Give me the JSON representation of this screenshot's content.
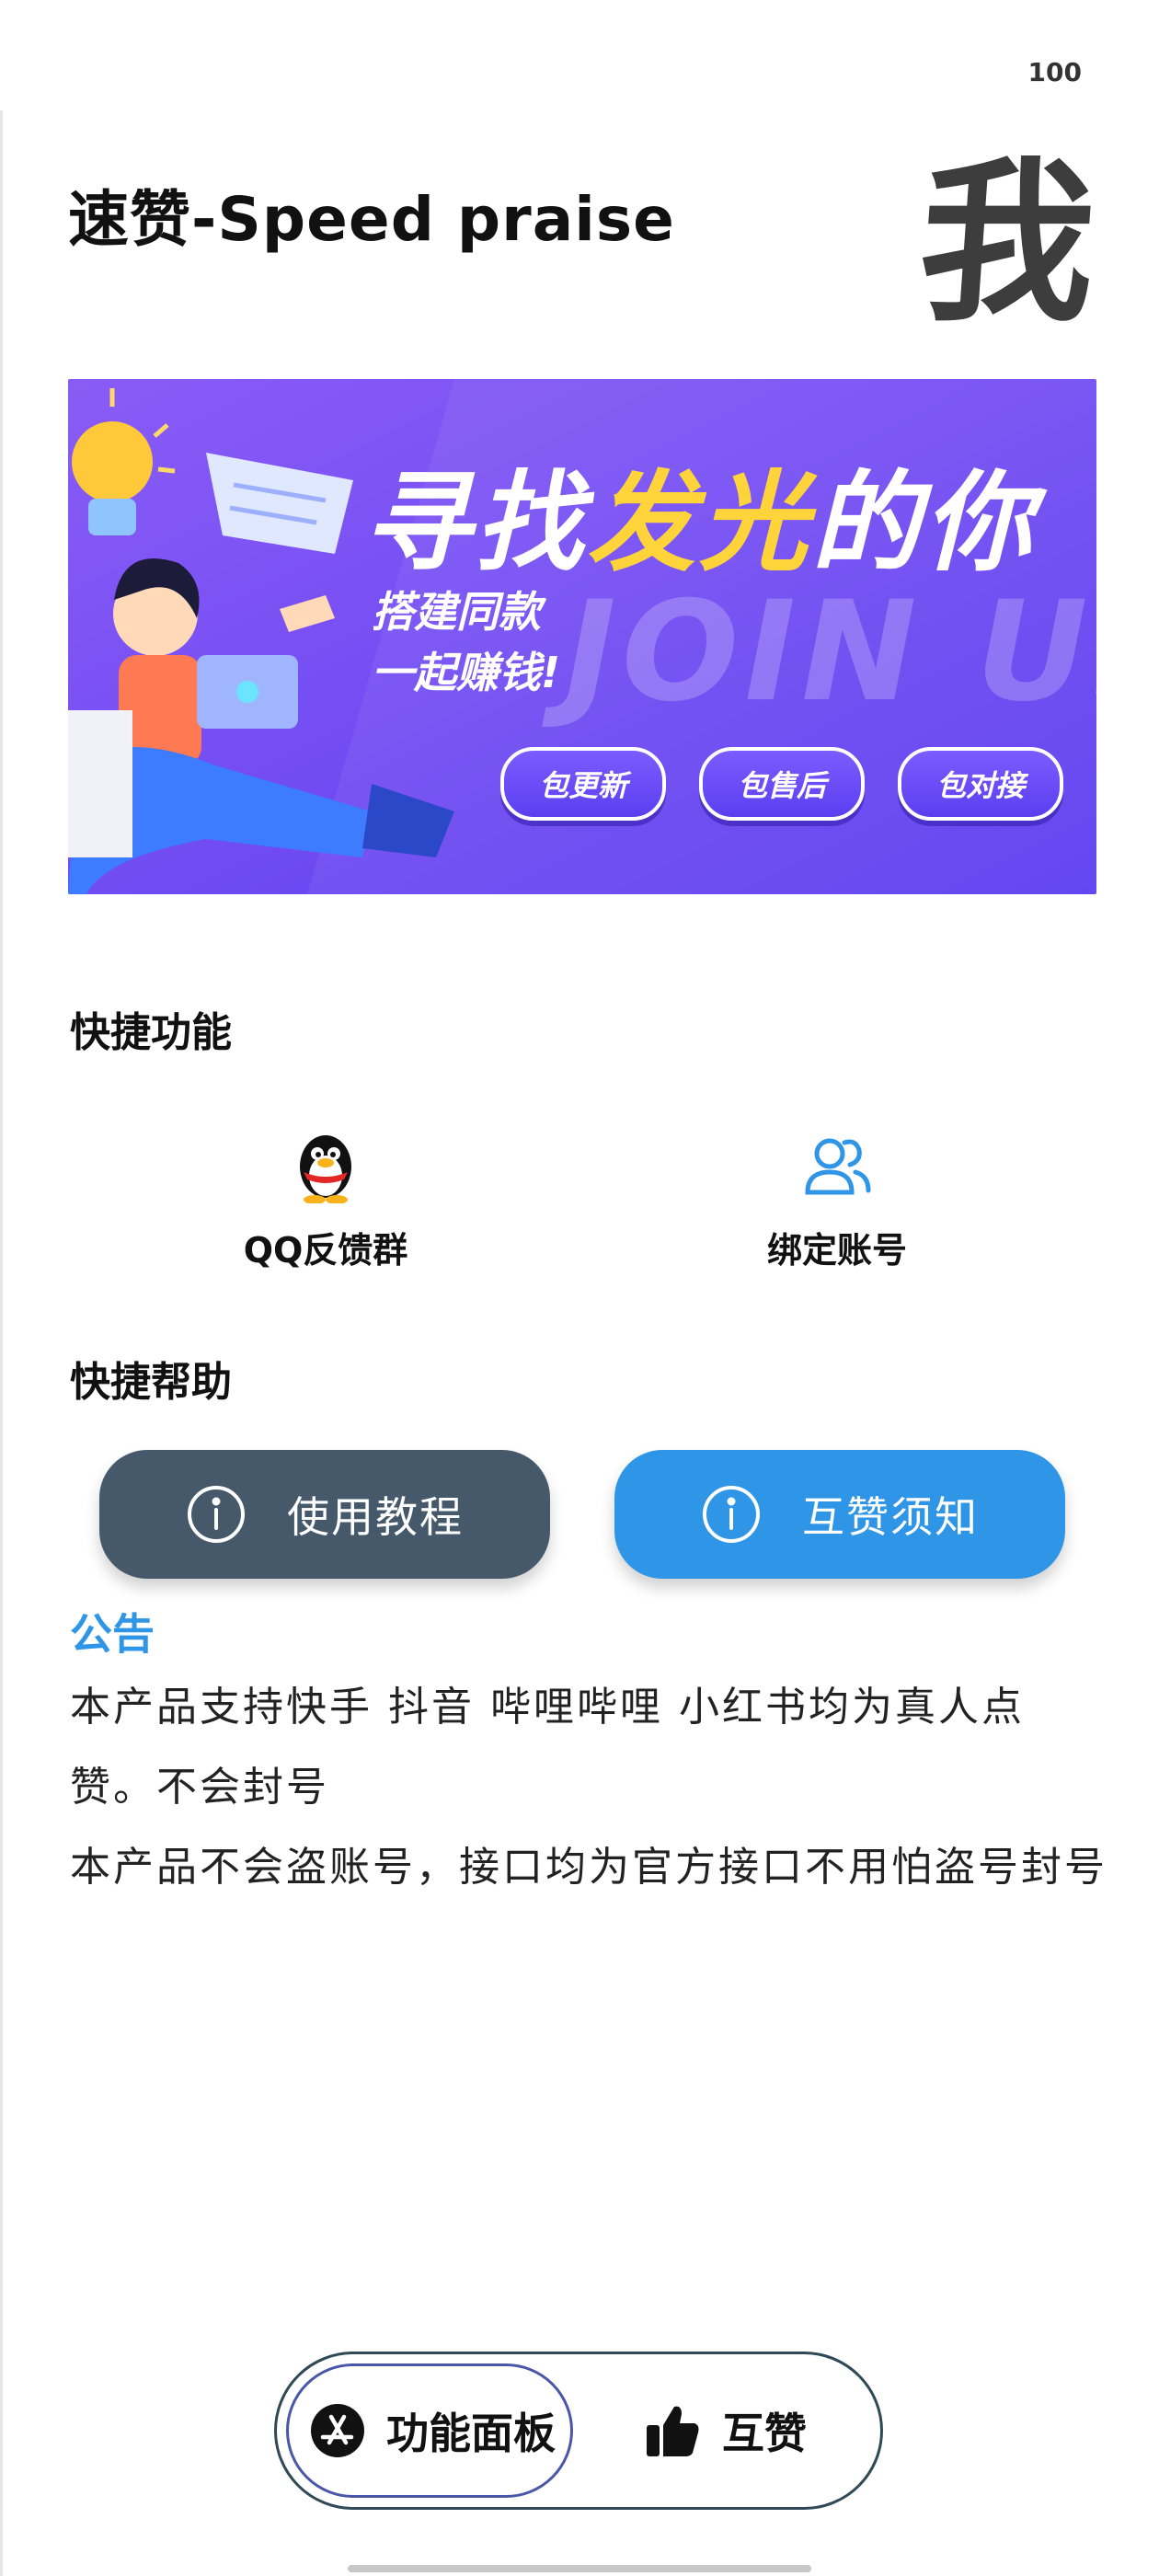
{
  "status_bar": {
    "battery": "100"
  },
  "header": {
    "title": "速赞-Speed praise",
    "me_label": "我"
  },
  "banner": {
    "headline_part1": "寻找",
    "headline_highlight": "发光",
    "headline_part2": "的你",
    "subtitle": "搭建同款\n一起赚钱!",
    "watermark": "JOIN US",
    "pills": [
      "包更新",
      "包售后",
      "包对接"
    ]
  },
  "quick_functions": {
    "title": "快捷功能",
    "items": [
      {
        "label": "QQ反馈群",
        "icon": "qq-penguin-icon"
      },
      {
        "label": "绑定账号",
        "icon": "users-icon"
      }
    ]
  },
  "quick_help": {
    "title": "快捷帮助",
    "buttons": [
      {
        "label": "使用教程",
        "icon": "info-icon",
        "color": "#46596b"
      },
      {
        "label": "互赞须知",
        "icon": "info-icon",
        "color": "#2f95e6"
      }
    ]
  },
  "notice": {
    "title": "公告",
    "lines": [
      "本产品支持快手 抖音 哔哩哔哩 小红书均为真人点赞。不会封号",
      "本产品不会盗账号，接口均为官方接口不用怕盗号封号"
    ]
  },
  "tabbar": {
    "tabs": [
      {
        "label": "功能面板",
        "icon": "app-store-icon",
        "active": true
      },
      {
        "label": "互赞",
        "icon": "thumbs-up-icon",
        "active": false
      }
    ]
  },
  "colors": {
    "accent": "#2f95e6",
    "dark_button": "#46596b",
    "banner_purple": "#6a45f5",
    "highlight_yellow": "#ffd43b"
  }
}
